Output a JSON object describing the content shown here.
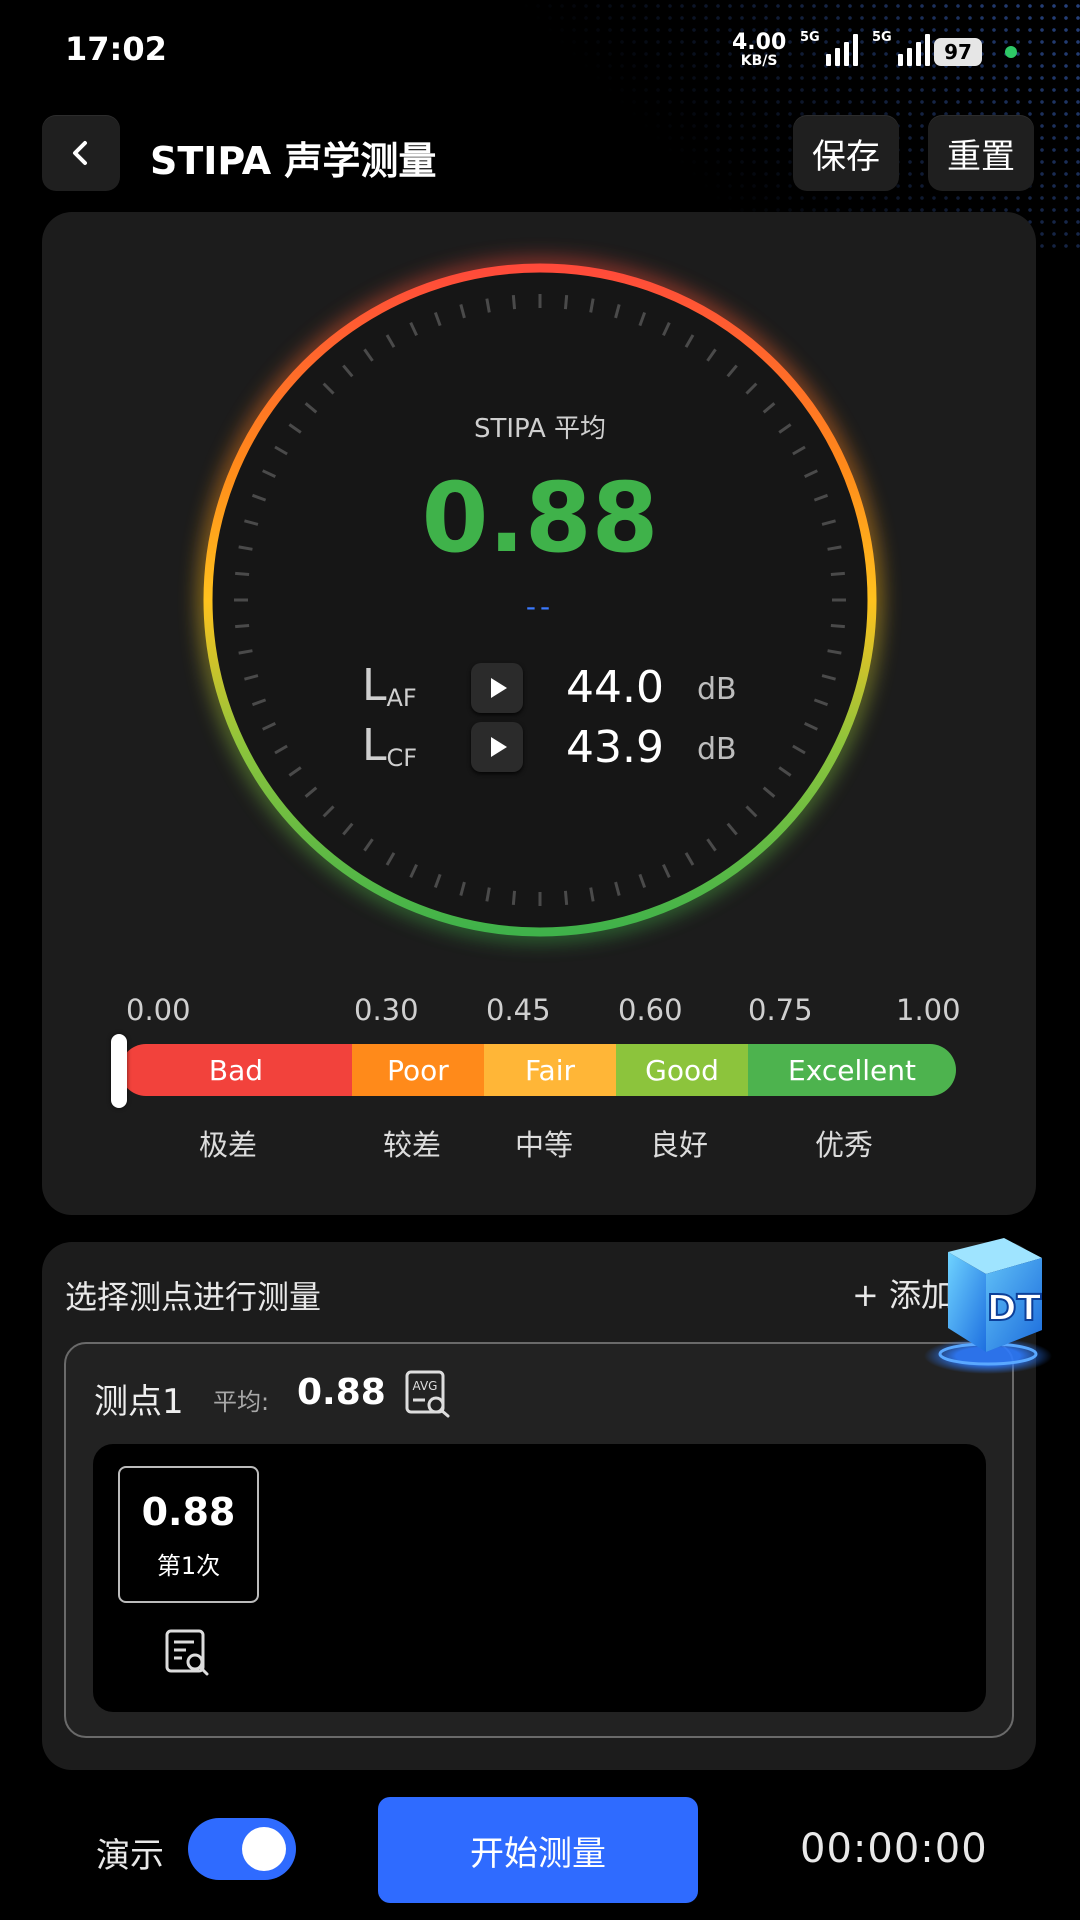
{
  "status_bar": {
    "time": "17:02",
    "net_speed": "4.00",
    "net_speed_unit": "KB/S",
    "signal_1_label": "5G",
    "signal_2_label": "5G",
    "battery": "97"
  },
  "header": {
    "title": "STIPA 声学测量",
    "save_label": "保存",
    "reset_label": "重置"
  },
  "gauge": {
    "label": "STIPA 平均",
    "value": "0.88",
    "sub_value": "--",
    "levels": [
      {
        "name": "L",
        "sub": "AF",
        "value": "44.0",
        "unit": "dB"
      },
      {
        "name": "L",
        "sub": "CF",
        "value": "43.9",
        "unit": "dB"
      }
    ],
    "arc_colors": [
      "#ff4a3a",
      "#ff8a1a",
      "#ffc21e",
      "#8cc43c",
      "#3fb24a"
    ]
  },
  "scale": {
    "ticks": [
      "0.00",
      "0.30",
      "0.45",
      "0.60",
      "0.75",
      "1.00"
    ],
    "segments": [
      {
        "en": "Bad",
        "cn": "极差",
        "color": "#f2423c"
      },
      {
        "en": "Poor",
        "cn": "较差",
        "color": "#ff8a1a"
      },
      {
        "en": "Fair",
        "cn": "中等",
        "color": "#ffb637"
      },
      {
        "en": "Good",
        "cn": "良好",
        "color": "#8cc43c"
      },
      {
        "en": "Excellent",
        "cn": "优秀",
        "color": "#4db34e"
      }
    ]
  },
  "points": {
    "select_label": "选择测点进行测量",
    "add_label": "+ 添加",
    "items": [
      {
        "name": "测点1",
        "avg_label": "平均:",
        "avg_value": "0.88",
        "avg_icon_text": "AVG",
        "runs": [
          {
            "value": "0.88",
            "label": "第1次"
          }
        ]
      }
    ]
  },
  "logo": {
    "text": "DT"
  },
  "footer": {
    "demo_label": "演示",
    "demo_on": true,
    "start_label": "开始测量",
    "timer": "00:00:00"
  }
}
